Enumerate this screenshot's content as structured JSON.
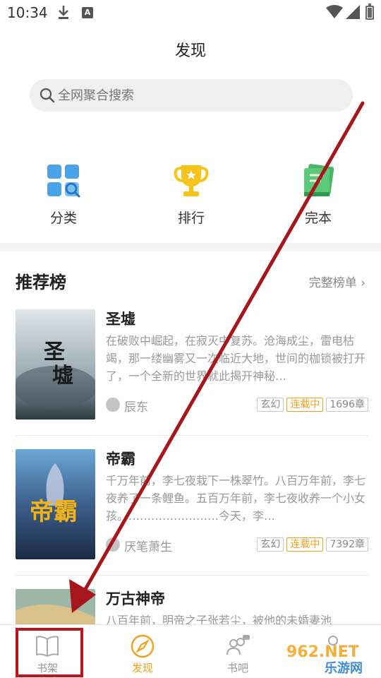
{
  "status": {
    "time": "10:34",
    "notif_badge": "A"
  },
  "page": {
    "title": "发现"
  },
  "search": {
    "placeholder": "全网聚合搜索"
  },
  "categories": [
    {
      "label": "分类",
      "icon": "category-grid-icon"
    },
    {
      "label": "排行",
      "icon": "trophy-icon"
    },
    {
      "label": "完本",
      "icon": "books-icon"
    }
  ],
  "recommend": {
    "title": "推荐榜",
    "more": "完整榜单 ›"
  },
  "books": [
    {
      "title": "圣墟",
      "desc": "在破败中崛起，在寂灭中复苏。沧海成尘，雷电枯竭，那一缕幽雾又一次临近大地，世间的枷锁被打开了，一个全新的世界就此揭开神秘…",
      "author": "辰东",
      "tags": [
        "玄幻",
        "连载中",
        "1696章"
      ]
    },
    {
      "title": "帝霸",
      "desc": "千万年前，李七夜栽下一株翠竹。八百万年前，李七夜养了一条鲤鱼。五百万年前，李七夜收养一个小女孩。……………………今天，李…",
      "author": "厌笔萧生",
      "tags": [
        "玄幻",
        "连载中",
        "7392章"
      ]
    },
    {
      "title": "万古神帝",
      "desc": "八百年前，明帝之子张若尘，被他的未婚妻池",
      "author": "",
      "tags": []
    }
  ],
  "nav": [
    {
      "label": "书架",
      "icon": "book-open-icon"
    },
    {
      "label": "发现",
      "icon": "compass-icon"
    },
    {
      "label": "书吧",
      "icon": "community-icon"
    },
    {
      "label": "",
      "icon": "profile-icon"
    }
  ],
  "watermark": {
    "top": "962.NET",
    "bottom": "乐游网"
  },
  "colors": {
    "accent": "#f0a019",
    "annotation": "#c0141b"
  }
}
